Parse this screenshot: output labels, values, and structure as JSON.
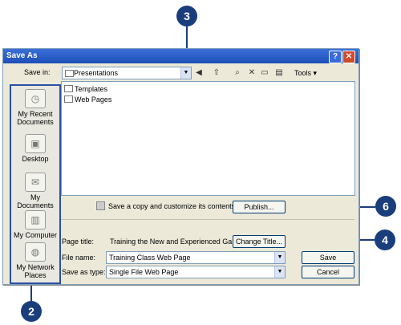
{
  "window": {
    "title": "Save As",
    "help_label": "?",
    "close_label": "✕"
  },
  "save_in": {
    "label": "Save in:",
    "value": "Presentations"
  },
  "toolbar": {
    "tools_label": "Tools ▾"
  },
  "places": [
    {
      "label": "My Recent Documents"
    },
    {
      "label": "Desktop"
    },
    {
      "label": "My Documents"
    },
    {
      "label": "My Computer"
    },
    {
      "label": "My Network Places"
    }
  ],
  "files": [
    {
      "name": "Templates"
    },
    {
      "name": "Web Pages"
    }
  ],
  "publish": {
    "info": "Save a copy and customize its contents",
    "button": "Publish..."
  },
  "page_title": {
    "label": "Page title:",
    "value": "Training the New and Experienced Ga...",
    "button": "Change Title..."
  },
  "file_name": {
    "label": "File name:",
    "value": "Training Class Web Page"
  },
  "save_as_type": {
    "label": "Save as type:",
    "value": "Single File Web Page"
  },
  "buttons": {
    "save": "Save",
    "cancel": "Cancel"
  },
  "callouts": {
    "c3": "3",
    "c6": "6",
    "c4": "4",
    "c2": "2"
  }
}
